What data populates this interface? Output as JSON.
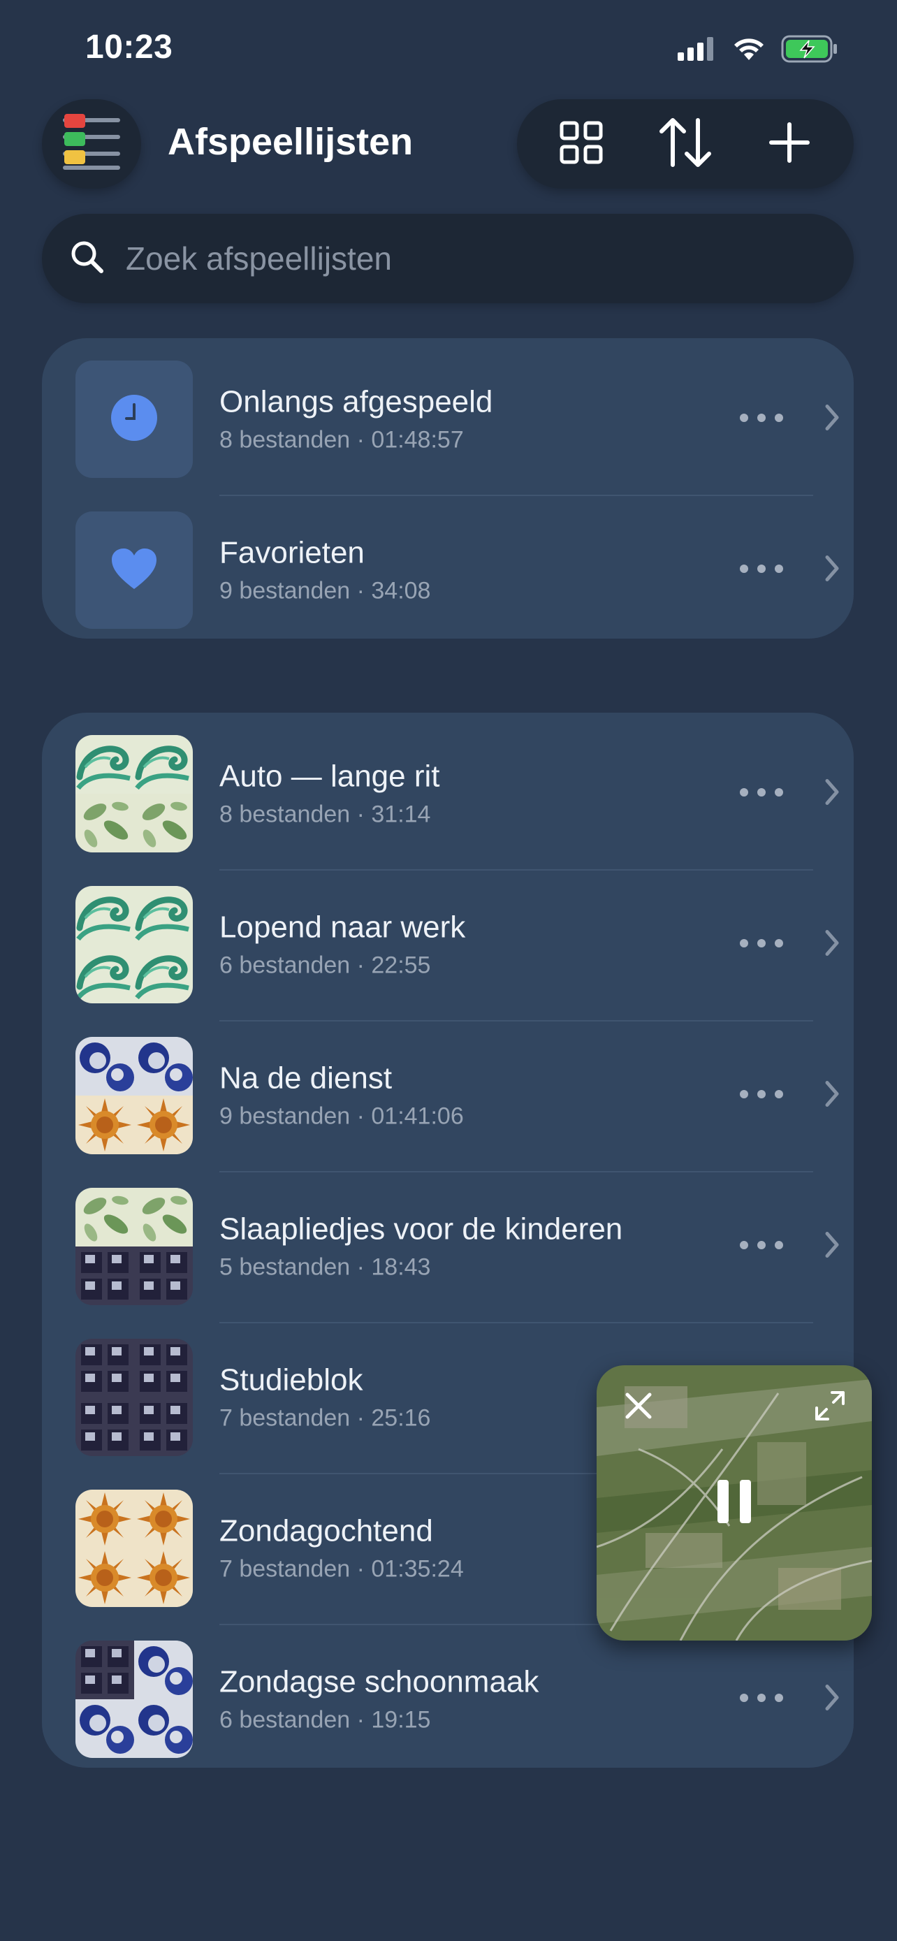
{
  "status_bar": {
    "time": "10:23",
    "icons": [
      "cellular-signal-icon",
      "wifi-icon",
      "battery-charging-icon"
    ]
  },
  "header": {
    "title": "Afspeellijsten",
    "menu_icon": "playlist-menu-icon",
    "toolbar": [
      "grid-view-icon",
      "sort-icon",
      "plus-icon"
    ]
  },
  "search": {
    "placeholder": "Zoek afspeellijsten"
  },
  "special_lists": [
    {
      "title": "Onlangs afgespeeld",
      "subtitle": "8 bestanden · 01:48:57",
      "icon": "clock-icon"
    },
    {
      "title": "Favorieten",
      "subtitle": "9 bestanden · 34:08",
      "icon": "heart-icon"
    }
  ],
  "playlists": [
    {
      "title": "Auto — lange rit",
      "subtitle": "8 bestanden · 31:14"
    },
    {
      "title": "Lopend naar werk",
      "subtitle": "6 bestanden · 22:55"
    },
    {
      "title": "Na de dienst",
      "subtitle": "9 bestanden · 01:41:06"
    },
    {
      "title": "Slaapliedjes voor de kinderen",
      "subtitle": "5 bestanden · 18:43"
    },
    {
      "title": "Studieblok",
      "subtitle": "7 bestanden · 25:16"
    },
    {
      "title": "Zondagochtend",
      "subtitle": "7 bestanden · 01:35:24"
    },
    {
      "title": "Zondagse schoonmaak",
      "subtitle": "6 bestanden · 19:15"
    }
  ],
  "mini_player": {
    "state": "playing",
    "icons": [
      "close-icon",
      "expand-icon",
      "pause-icon"
    ]
  },
  "colors": {
    "background": "#26344a",
    "card": "#324660",
    "control": "#1d2735",
    "accent_blue": "#5b8def",
    "battery_green": "#3ec85a"
  }
}
